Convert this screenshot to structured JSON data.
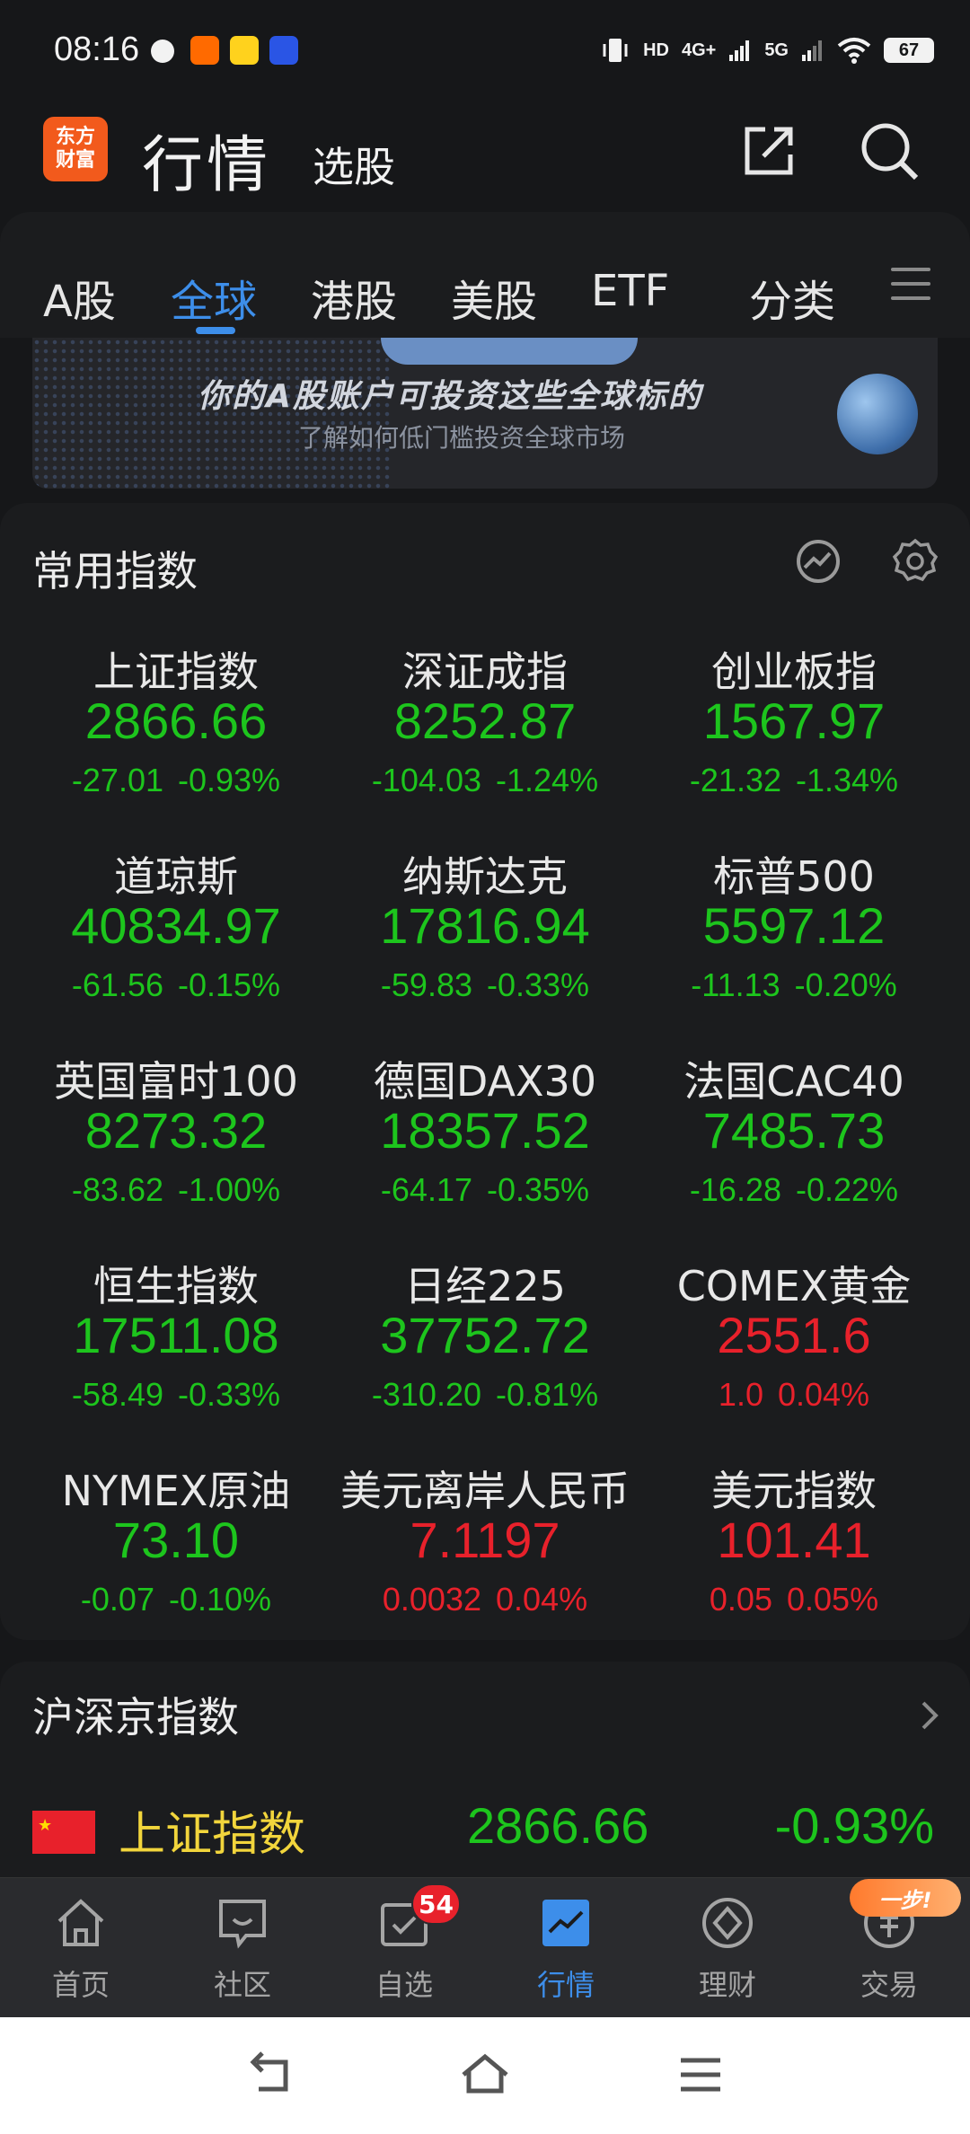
{
  "status_bar": {
    "time": "08:16",
    "network_label": "HD",
    "signal_4g": "4G+",
    "signal_5g": "5G",
    "battery": "67",
    "icons": [
      "weibo-icon",
      "taobao-icon",
      "weibo-app-icon",
      "browser-icon",
      "vibrate-icon",
      "wifi-icon"
    ]
  },
  "header": {
    "logo_line1": "东方",
    "logo_line2": "财富",
    "title": "行情",
    "subtitle": "选股"
  },
  "tabs": [
    "A股",
    "全球",
    "港股",
    "美股",
    "ETF",
    "分类"
  ],
  "active_tab": "全球",
  "banner": {
    "headline": "你的A股账户可投资这些全球标的",
    "subline": "了解如何低门槛投资全球市场"
  },
  "common_indices": {
    "title": "常用指数",
    "items": [
      {
        "name": "上证指数",
        "price": "2866.66",
        "change": "-27.01",
        "pct": "-0.93%",
        "dir": "down"
      },
      {
        "name": "深证成指",
        "price": "8252.87",
        "change": "-104.03",
        "pct": "-1.24%",
        "dir": "down"
      },
      {
        "name": "创业板指",
        "price": "1567.97",
        "change": "-21.32",
        "pct": "-1.34%",
        "dir": "down"
      },
      {
        "name": "道琼斯",
        "price": "40834.97",
        "change": "-61.56",
        "pct": "-0.15%",
        "dir": "down"
      },
      {
        "name": "纳斯达克",
        "price": "17816.94",
        "change": "-59.83",
        "pct": "-0.33%",
        "dir": "down"
      },
      {
        "name": "标普500",
        "price": "5597.12",
        "change": "-11.13",
        "pct": "-0.20%",
        "dir": "down"
      },
      {
        "name": "英国富时100",
        "price": "8273.32",
        "change": "-83.62",
        "pct": "-1.00%",
        "dir": "down"
      },
      {
        "name": "德国DAX30",
        "price": "18357.52",
        "change": "-64.17",
        "pct": "-0.35%",
        "dir": "down"
      },
      {
        "name": "法国CAC40",
        "price": "7485.73",
        "change": "-16.28",
        "pct": "-0.22%",
        "dir": "down"
      },
      {
        "name": "恒生指数",
        "price": "17511.08",
        "change": "-58.49",
        "pct": "-0.33%",
        "dir": "down"
      },
      {
        "name": "日经225",
        "price": "37752.72",
        "change": "-310.20",
        "pct": "-0.81%",
        "dir": "down"
      },
      {
        "name": "COMEX黄金",
        "price": "2551.6",
        "change": "1.0",
        "pct": "0.04%",
        "dir": "up"
      },
      {
        "name": "NYMEX原油",
        "price": "73.10",
        "change": "-0.07",
        "pct": "-0.10%",
        "dir": "down"
      },
      {
        "name": "美元离岸人民币",
        "price": "7.1197",
        "change": "0.0032",
        "pct": "0.04%",
        "dir": "up"
      },
      {
        "name": "美元指数",
        "price": "101.41",
        "change": "0.05",
        "pct": "0.05%",
        "dir": "up"
      }
    ]
  },
  "hsj_indices": {
    "title": "沪深京指数",
    "rows": [
      {
        "name": "上证指数",
        "price": "2866.66",
        "pct": "-0.93%",
        "dir": "down"
      }
    ]
  },
  "bottom_nav": {
    "items": [
      {
        "label": "首页",
        "icon": "home-icon"
      },
      {
        "label": "社区",
        "icon": "community-icon"
      },
      {
        "label": "自选",
        "icon": "watchlist-icon",
        "badge": "54"
      },
      {
        "label": "行情",
        "icon": "market-icon",
        "active": true
      },
      {
        "label": "理财",
        "icon": "wealth-icon"
      },
      {
        "label": "交易",
        "icon": "trade-icon"
      }
    ],
    "promo_label": "一步!"
  },
  "colors": {
    "down": "#1dc51d",
    "up": "#e8212b",
    "accent": "#3d8eea",
    "brand": "#f25a1c"
  }
}
